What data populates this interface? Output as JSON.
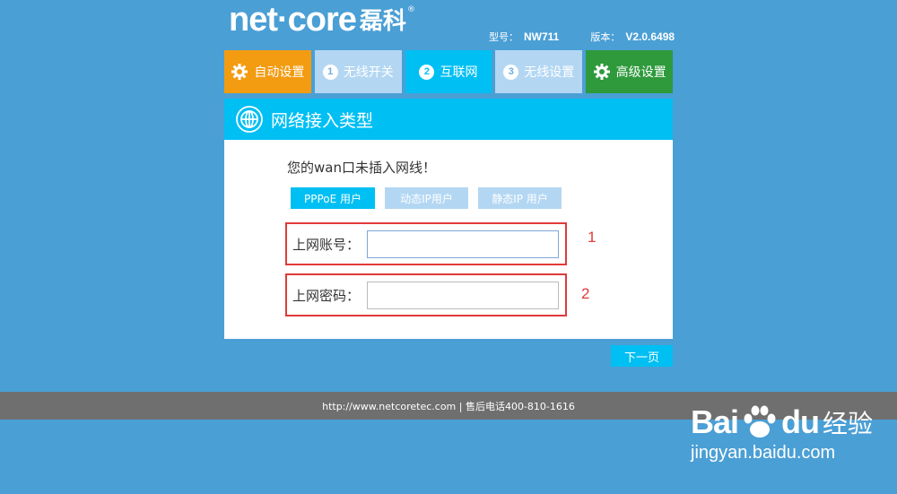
{
  "brand": {
    "logo_text": "net·core",
    "logo_cn": "磊科",
    "logo_reg": "®"
  },
  "model": {
    "model_label": "型号：",
    "model_value": "NW711",
    "version_label": "版本：",
    "version_value": "V2.0.6498"
  },
  "steps": [
    {
      "label": "自动设置",
      "icon": "gear-icon"
    },
    {
      "number": "1",
      "label": "无线开关"
    },
    {
      "number": "2",
      "label": "互联网"
    },
    {
      "number": "3",
      "label": "无线设置"
    },
    {
      "label": "高级设置",
      "icon": "gear-icon"
    }
  ],
  "panel": {
    "title": "网络接入类型",
    "icon": "globe-icon",
    "warning": "您的wan口未插入网线！",
    "types": [
      "PPPoE 用户",
      "动态IP用户",
      "静态IP 用户"
    ],
    "account_label": "上网账号：",
    "account_value": "",
    "password_label": "上网密码：",
    "password_value": ""
  },
  "annotations": [
    "1",
    "2"
  ],
  "next_button": "下一页",
  "footer": "http://www.netcoretec.com | 售后电话400-810-1616",
  "watermark": {
    "bai": "Bai",
    "du": "du",
    "jingyan": "经验",
    "url": "jingyan.baidu.com"
  },
  "colors": {
    "background": "#4a9fd5",
    "accent": "#00bff3",
    "orange": "#f39c12",
    "green": "#2e9a3c",
    "inactive": "#b3d7f3",
    "annotation_red": "#e03a3a",
    "footer": "#6f6f6f"
  }
}
